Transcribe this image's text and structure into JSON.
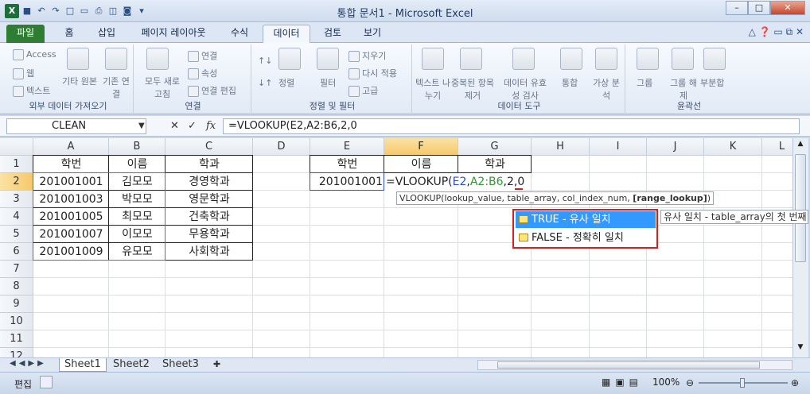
{
  "window": {
    "title": "통합 문서1 - Microsoft Excel"
  },
  "tabs": [
    {
      "label": "파일"
    },
    {
      "label": "홈"
    },
    {
      "label": "삽입"
    },
    {
      "label": "페이지 레이아웃"
    },
    {
      "label": "수식"
    },
    {
      "label": "데이터"
    },
    {
      "label": "검토"
    },
    {
      "label": "보기"
    }
  ],
  "ribbon": {
    "groups": [
      {
        "label": "외부 데이터 가져오기",
        "items": [
          "Access",
          "웹",
          "텍스트",
          "기타 원본",
          "기존 연결"
        ]
      },
      {
        "label": "연결",
        "items": [
          "모두 새로 고침",
          "연결",
          "속성",
          "연결 편집"
        ]
      },
      {
        "label": "정렬 및 필터",
        "items": [
          "정렬",
          "필터",
          "지우기",
          "다시 적용",
          "고급"
        ]
      },
      {
        "label": "데이터 도구",
        "items": [
          "텍스트 나누기",
          "중복된 항목 제거",
          "데이터 유효성 검사",
          "통합",
          "가상 분석"
        ]
      },
      {
        "label": "윤곽선",
        "items": [
          "그룹",
          "그룹 해제",
          "부분합"
        ]
      }
    ]
  },
  "formula_bar": {
    "name_box": "CLEAN",
    "formula": "=VLOOKUP(E2,A2:B6,2,0"
  },
  "columns": [
    "A",
    "B",
    "C",
    "D",
    "E",
    "F",
    "G",
    "H",
    "I",
    "J",
    "K",
    "L"
  ],
  "rows": [
    "1",
    "2",
    "3",
    "4",
    "5",
    "6",
    "7",
    "8",
    "9",
    "10",
    "11",
    "12"
  ],
  "table": {
    "headers": [
      "학번",
      "이름",
      "학과"
    ],
    "rows": [
      [
        "201001001",
        "김모모",
        "경영학과"
      ],
      [
        "201001003",
        "박모모",
        "영문학과"
      ],
      [
        "201001005",
        "최모모",
        "건축학과"
      ],
      [
        "201001007",
        "이모모",
        "무용학과"
      ],
      [
        "201001009",
        "유모모",
        "사회학과"
      ]
    ]
  },
  "lookup": {
    "headers": [
      "학번",
      "이름",
      "학과"
    ],
    "e2": "201001001",
    "f2_prefix": "=VLOOKUP(",
    "f2_ref1": "E2",
    "f2_ref2": "A2:B6",
    "f2_tail": ",2,0"
  },
  "tooltip": {
    "prefix": "VLOOKUP(lookup_value, table_array, col_index_num, ",
    "bold": "[range_lookup]",
    "suffix": ")"
  },
  "autocomplete": [
    {
      "label": "TRUE - 유사 일치"
    },
    {
      "label": "FALSE - 정확히 일치"
    }
  ],
  "ac_tooltip": "유사 일치 - table_array의 첫 번째",
  "sheets": [
    "Sheet1",
    "Sheet2",
    "Sheet3"
  ],
  "status": {
    "mode": "편집",
    "zoom": "100%"
  }
}
